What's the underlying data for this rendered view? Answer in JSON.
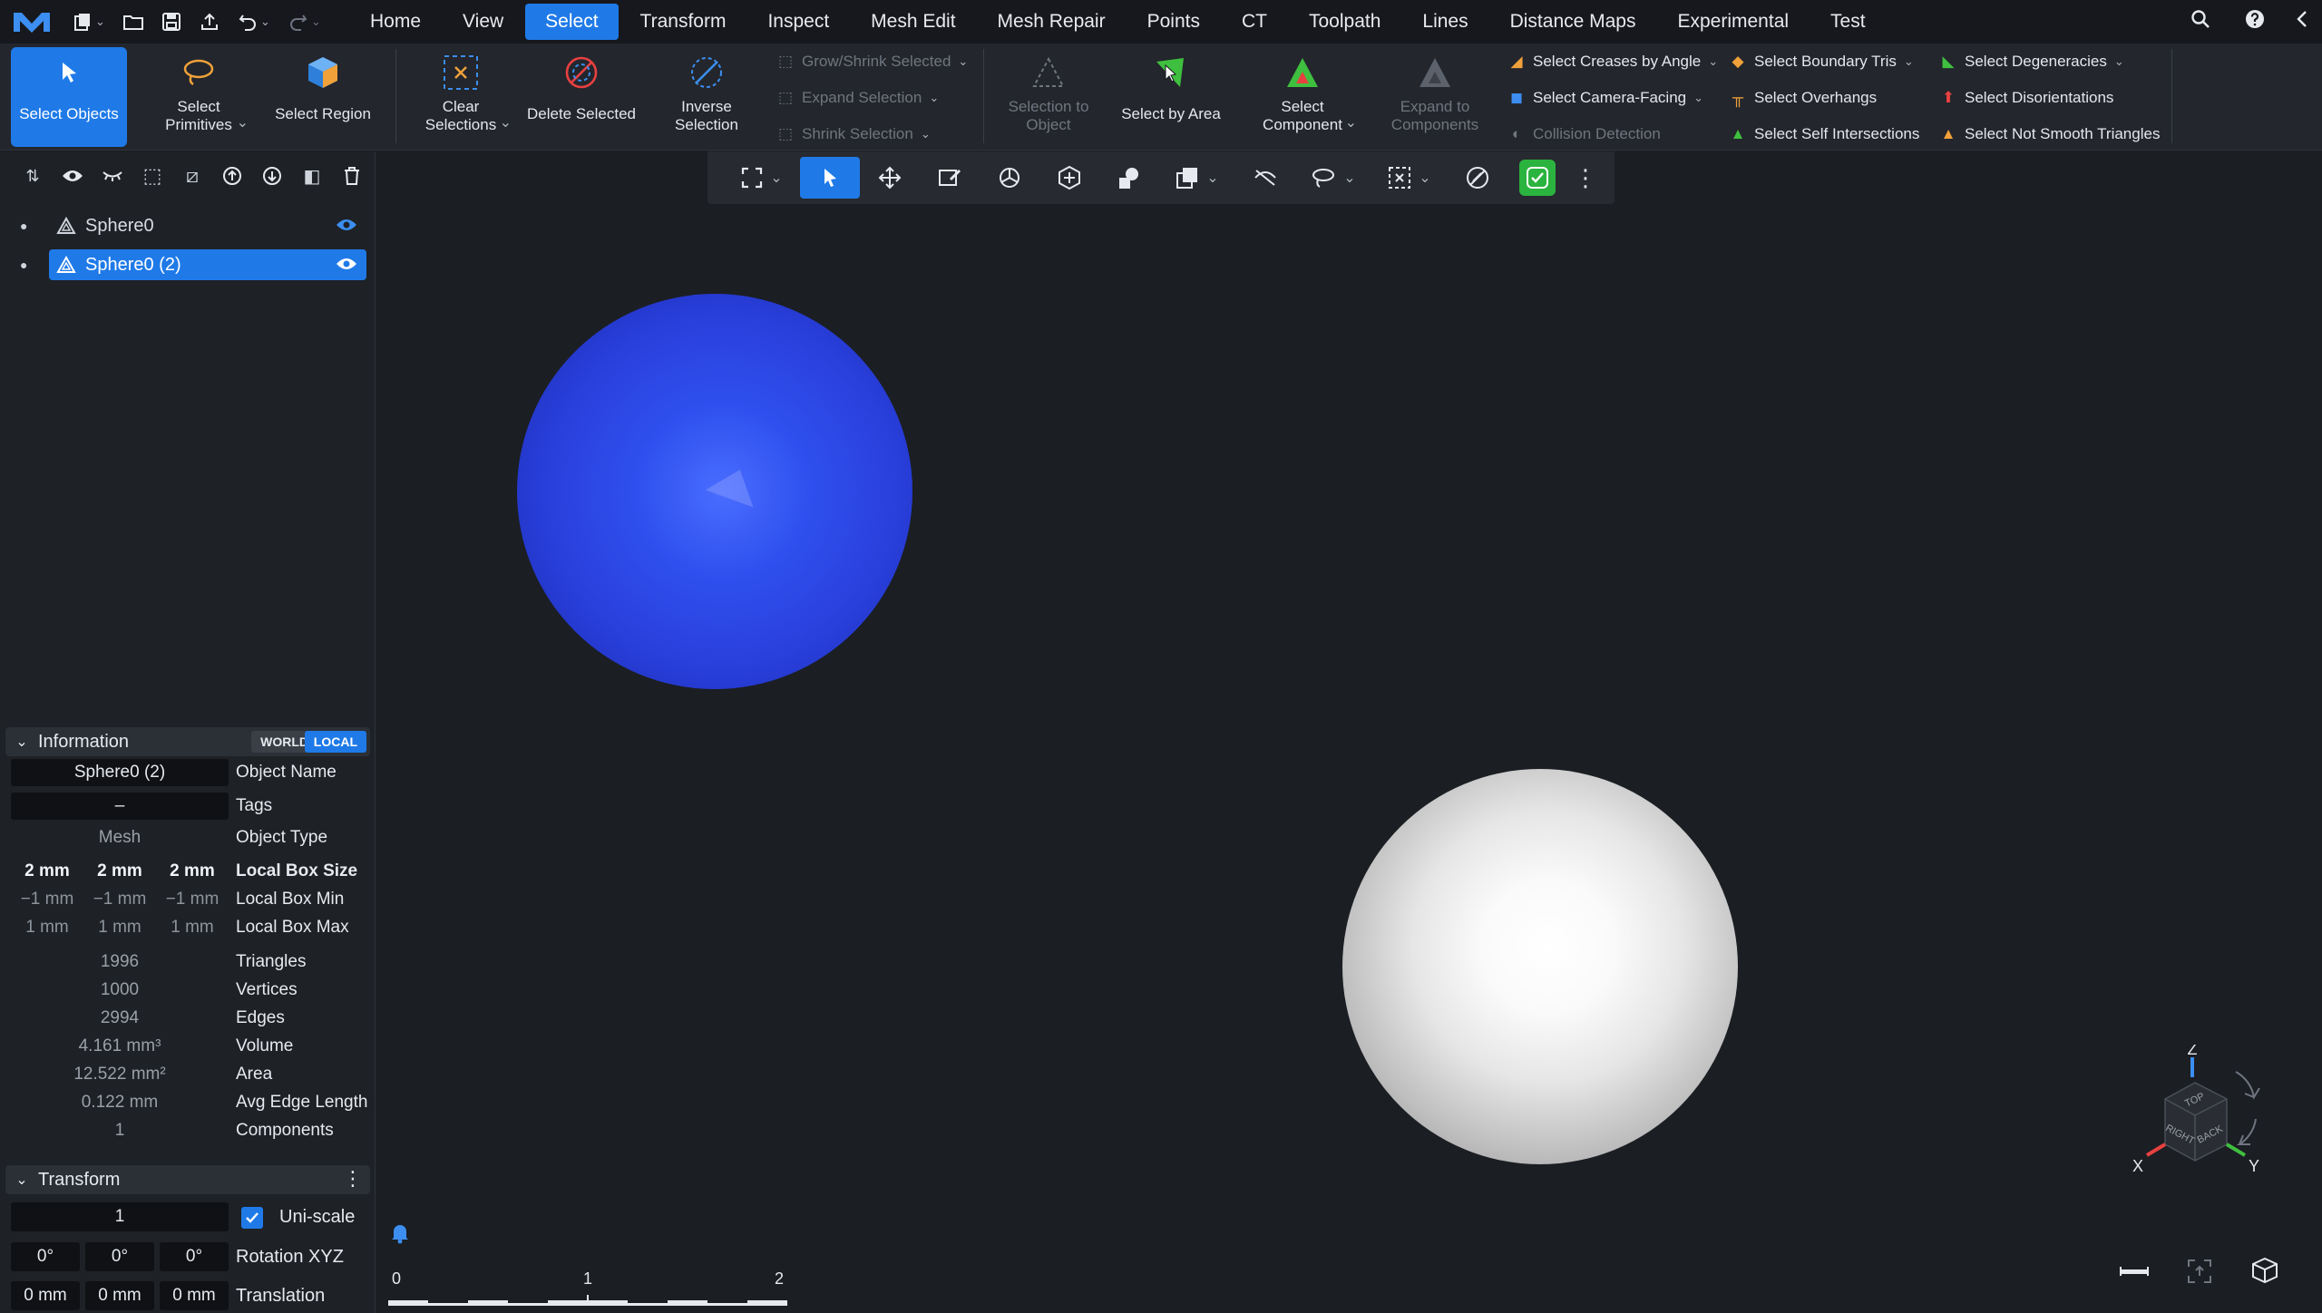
{
  "menu": {
    "tabs": [
      "Home",
      "View",
      "Select",
      "Transform",
      "Inspect",
      "Mesh Edit",
      "Mesh Repair",
      "Points",
      "CT",
      "Toolpath",
      "Lines",
      "Distance Maps",
      "Experimental",
      "Test"
    ],
    "active_tab": "Select"
  },
  "ribbon": {
    "select_objects": "Select Objects",
    "select_primitives": "Select Primitives",
    "select_region": "Select Region",
    "clear_selections": "Clear Selections",
    "delete_selected": "Delete Selected",
    "inverse_selection": "Inverse Selection",
    "grow_shrink_selected": "Grow/Shrink Selected",
    "expand_selection": "Expand Selection",
    "shrink_selection": "Shrink Selection",
    "selection_to_object": "Selection to Object",
    "select_by_area": "Select by Area",
    "select_component": "Select Component",
    "expand_to_components": "Expand to Components",
    "select_creases_by_angle": "Select Creases by Angle",
    "select_camera_facing": "Select Camera-Facing",
    "collision_detection": "Collision Detection",
    "select_boundary_tris": "Select Boundary Tris",
    "select_overhangs": "Select Overhangs",
    "select_self_intersections": "Select Self Intersections",
    "select_degeneracies": "Select Degeneracies",
    "select_disorientations": "Select Disorientations",
    "select_not_smooth_triangles": "Select Not Smooth Triangles"
  },
  "scene_tree": {
    "items": [
      {
        "name": "Sphere0",
        "selected": false
      },
      {
        "name": "Sphere0 (2)",
        "selected": true
      }
    ]
  },
  "information": {
    "title": "Information",
    "world": "WORLD",
    "local": "LOCAL",
    "object_name_value": "Sphere0 (2)",
    "object_name_label": "Object Name",
    "tags_value": "–",
    "tags_label": "Tags",
    "object_type_value": "Mesh",
    "object_type_label": "Object Type",
    "box_size": [
      "2 mm",
      "2 mm",
      "2 mm"
    ],
    "box_size_label": "Local Box Size",
    "box_min": [
      "−1 mm",
      "−1 mm",
      "−1 mm"
    ],
    "box_min_label": "Local Box Min",
    "box_max": [
      "1 mm",
      "1 mm",
      "1 mm"
    ],
    "box_max_label": "Local Box Max",
    "triangles_value": "1996",
    "triangles_label": "Triangles",
    "vertices_value": "1000",
    "vertices_label": "Vertices",
    "edges_value": "2994",
    "edges_label": "Edges",
    "volume_value": "4.161 mm³",
    "volume_label": "Volume",
    "area_value": "12.522 mm²",
    "area_label": "Area",
    "avg_edge_value": "0.122 mm",
    "avg_edge_label": "Avg Edge Length",
    "components_value": "1",
    "components_label": "Components"
  },
  "transform": {
    "title": "Transform",
    "scale_value": "1",
    "uniscale_label": "Uni-scale",
    "uniscale_checked": true,
    "rotation": [
      "0°",
      "0°",
      "0°"
    ],
    "rotation_label": "Rotation XYZ",
    "translation": [
      "0 mm",
      "0 mm",
      "0 mm"
    ],
    "translation_label": "Translation"
  },
  "viewport": {
    "scale_ticks": [
      "0",
      "1",
      "2"
    ],
    "axes": {
      "z": "Z",
      "x": "X",
      "y": "Y"
    },
    "cube_faces": {
      "top": "TOP",
      "right": "RIGHT",
      "back": "BACK"
    }
  },
  "colors": {
    "accent": "#1f7ae8",
    "selected_sphere": "#2a47e6",
    "unselected_sphere": "#e8e8e8"
  }
}
